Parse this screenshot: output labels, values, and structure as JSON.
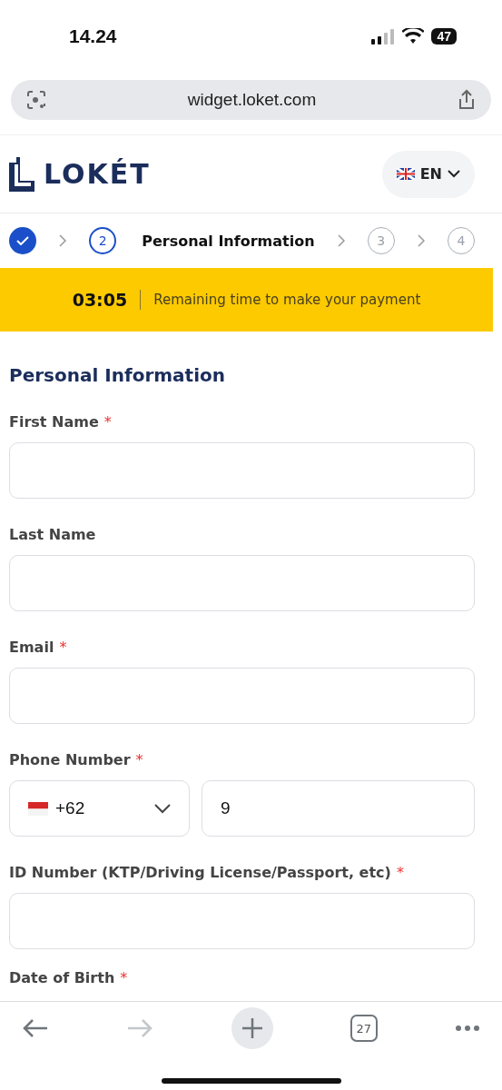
{
  "status_bar": {
    "time": "14.24",
    "battery": "47"
  },
  "browser": {
    "url": "widget.loket.com",
    "tab_count": "27"
  },
  "header": {
    "logo": "LOKÉT",
    "language": "EN"
  },
  "steps": [
    {
      "kind": "done"
    },
    {
      "number": "2",
      "label": "Personal Information",
      "kind": "current"
    },
    {
      "number": "3",
      "kind": "upcoming"
    },
    {
      "number": "4",
      "kind": "upcoming"
    }
  ],
  "timer": {
    "time": "03:05",
    "message": "Remaining time to make your payment"
  },
  "form": {
    "title": "Personal Information",
    "fields": [
      {
        "kind": "text",
        "label": "First Name",
        "required_mark": "*"
      },
      {
        "kind": "text",
        "label": "Last Name"
      },
      {
        "kind": "text",
        "label": "Email",
        "required_mark": "*"
      },
      {
        "kind": "phone",
        "label": "Phone Number",
        "required_mark": "*",
        "country_code": "+62",
        "value": "9"
      },
      {
        "kind": "text",
        "label": "ID Number (KTP/Driving License/Passport, etc)",
        "required_mark": "*"
      },
      {
        "kind": "cut",
        "label": "Date of Birth",
        "required_mark": "*"
      }
    ]
  }
}
